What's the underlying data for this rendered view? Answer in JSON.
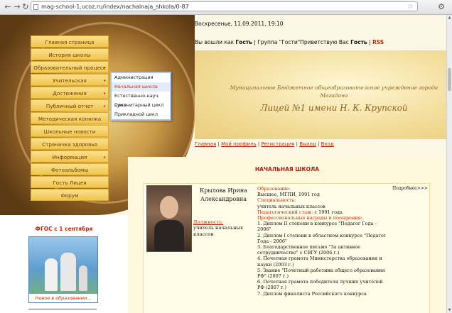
{
  "browser": {
    "url": "mag-school-1.ucoz.ru/index/nachalnaja_shkola/0-87"
  },
  "sidebar": {
    "menu": [
      {
        "label": "Главная страница",
        "sub": false
      },
      {
        "label": "История школы",
        "sub": false
      },
      {
        "label": "Образовательный процесс",
        "sub": true
      },
      {
        "label": "Учительская",
        "sub": true
      },
      {
        "label": "Достижения",
        "sub": true
      },
      {
        "label": "Публичный отчет",
        "sub": true
      },
      {
        "label": "Методическая копилка",
        "sub": false
      },
      {
        "label": "Школьные новости",
        "sub": false
      },
      {
        "label": "Страничка здоровья",
        "sub": false
      },
      {
        "label": "Информация",
        "sub": true
      },
      {
        "label": "Фотоальбомы",
        "sub": false
      },
      {
        "label": "Гость Лицея",
        "sub": false
      },
      {
        "label": "Форум",
        "sub": false
      }
    ],
    "submenu": [
      {
        "label": "Администрация",
        "active": false
      },
      {
        "label": "Начальная школа",
        "active": true
      },
      {
        "label": "Естественно-науч. цикл",
        "active": false
      },
      {
        "label": "Гуманитарный цикл",
        "active": false
      },
      {
        "label": "Прикладной цикл",
        "active": false
      }
    ],
    "fgos_title": "ФГОС с 1 сентября",
    "promo_caption": "Новое в образовании..."
  },
  "header": {
    "date": "Воскресенье, 11.09.2011, 19:10",
    "welcome_prefix": "Вы вошли как",
    "welcome_user": "Гость",
    "welcome_group": "| Группа \"Гости\"Приветствую Вас",
    "welcome_user2": "Гость",
    "rss": "RSS",
    "institution": "Муниципальное Бюджетное общеобразовательное учреждение города Магадана",
    "school_name": "Лицей №1 имени Н. К. Крупской"
  },
  "nav_links": [
    "Главная",
    "Мой профиль",
    "Регистрация",
    "Выход",
    "Вход"
  ],
  "content": {
    "section_title": "НАЧАЛЬНАЯ ШКОЛА",
    "teacher": {
      "name": "Крылова Ирина Александровна",
      "position_label": "Должность:",
      "position": "учитель начальных классов",
      "more": "Подробнее>>>",
      "education_label": "Образование:",
      "education": "Высшее, МГПИ, 1991 год",
      "specialty_label": "Специальность:",
      "specialty": "учитель начальных классов",
      "experience_label": "Педагогический стаж:",
      "experience": "с 1991 года",
      "awards_label": "Профессиональные награды и поощрения:",
      "awards": [
        "1. Диплом II степени в конкурсе \"Педагог Года - 2006\"",
        "2. Диплом I степени в областном конкурсе \"Педагог Года - 2006\"",
        "3. Благодарственное письмо \"За активное сотрудничество\" с СВГУ (2006 г.)",
        "4. Почетная грамота Министерства образования и науки (2003 г.)",
        "5. Звание \"Почетный работник общего образования РФ\" (2007 г.)",
        "6. Почетная грамота победителя лучших учителей РФ (2007 г.)",
        "7. Диплом финалиста Российского конкурса"
      ]
    }
  }
}
